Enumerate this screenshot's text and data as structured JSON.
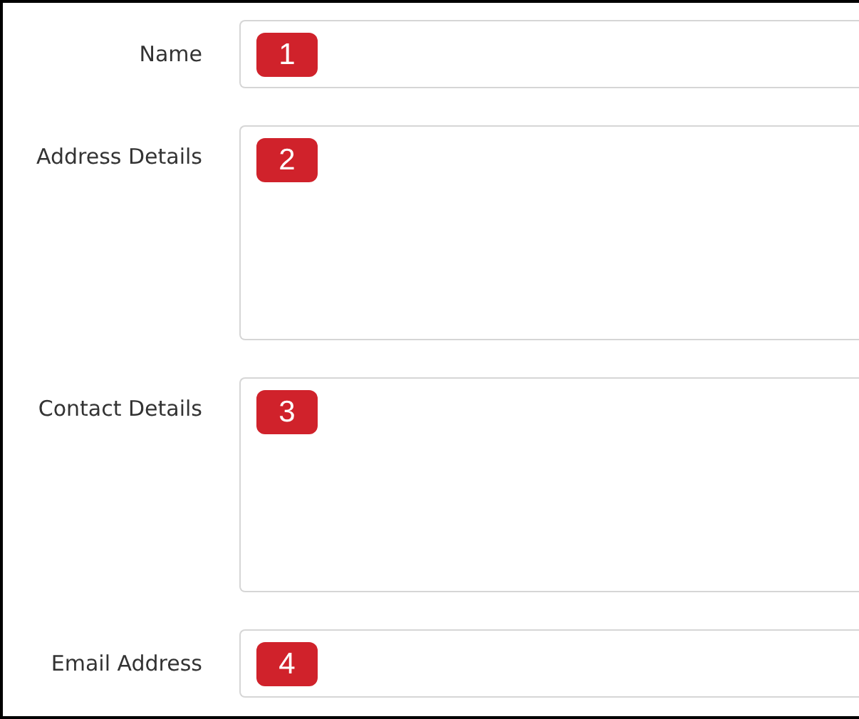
{
  "fields": [
    {
      "label": "Name",
      "kind": "input",
      "marker": "1"
    },
    {
      "label": "Address Details",
      "kind": "textarea",
      "marker": "2"
    },
    {
      "label": "Contact Details",
      "kind": "textarea",
      "marker": "3"
    },
    {
      "label": "Email Address",
      "kind": "input",
      "marker": "4"
    }
  ]
}
